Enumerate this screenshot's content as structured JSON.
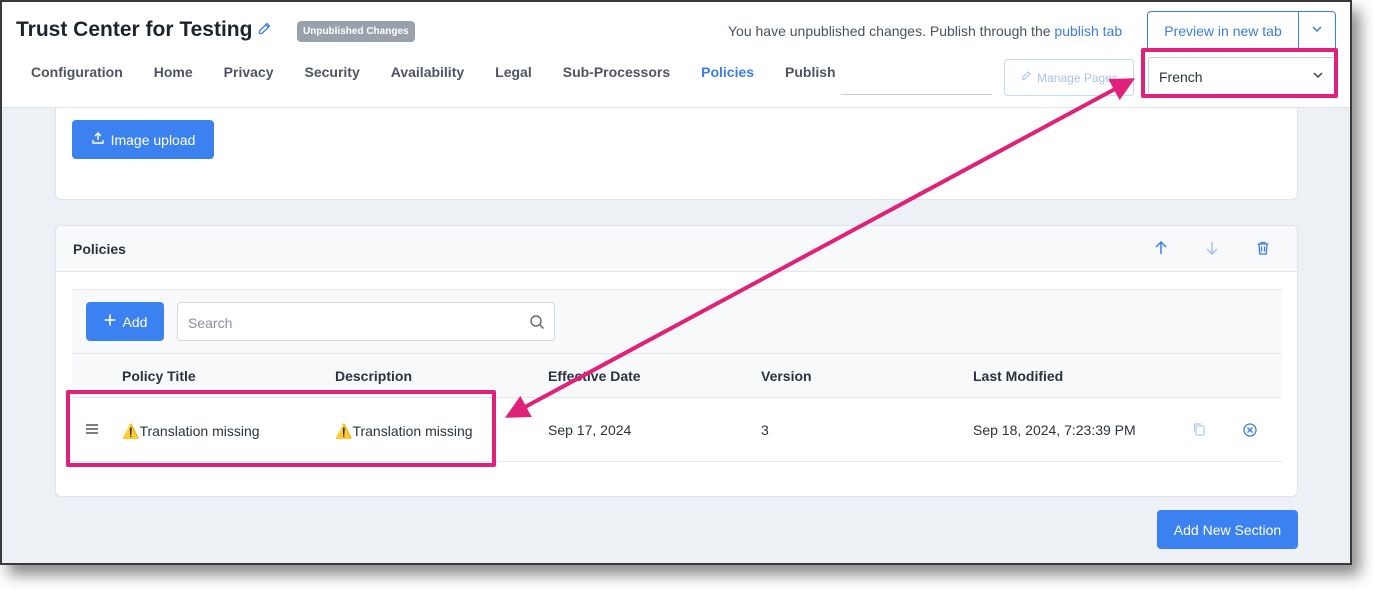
{
  "header": {
    "title": "Trust Center for Testing",
    "badge": "Unpublished Changes",
    "notice_text": "You have unpublished changes. Publish through the",
    "notice_link": "publish tab",
    "preview_label": "Preview in new tab"
  },
  "tabs": [
    {
      "label": "Configuration"
    },
    {
      "label": "Home"
    },
    {
      "label": "Privacy"
    },
    {
      "label": "Security"
    },
    {
      "label": "Availability"
    },
    {
      "label": "Legal"
    },
    {
      "label": "Sub-Processors"
    },
    {
      "label": "Policies",
      "active": true
    },
    {
      "label": "Publish"
    }
  ],
  "manage_pages_label": "Manage Pages",
  "language_select": {
    "value": "French"
  },
  "upload": {
    "label": "Image upload"
  },
  "policies": {
    "title": "Policies",
    "add_label": "Add",
    "search_placeholder": "Search",
    "columns": [
      "Policy Title",
      "Description",
      "Effective Date",
      "Version",
      "Last Modified"
    ],
    "rows": [
      {
        "title": "Translation missing",
        "description": "Translation missing",
        "effective_date": "Sep 17, 2024",
        "version": "3",
        "last_modified": "Sep 18, 2024, 7:23:39 PM"
      }
    ]
  },
  "add_section_label": "Add New Section",
  "colors": {
    "accent": "#3b82f0",
    "highlight": "#e0217a"
  },
  "icons": [
    "pencil-icon",
    "chevron-down-icon",
    "upload-icon",
    "arrow-up-icon",
    "arrow-down-icon",
    "trash-icon",
    "plus-icon",
    "search-icon",
    "drag-handle-icon",
    "warning-icon",
    "copy-icon",
    "remove-icon"
  ]
}
